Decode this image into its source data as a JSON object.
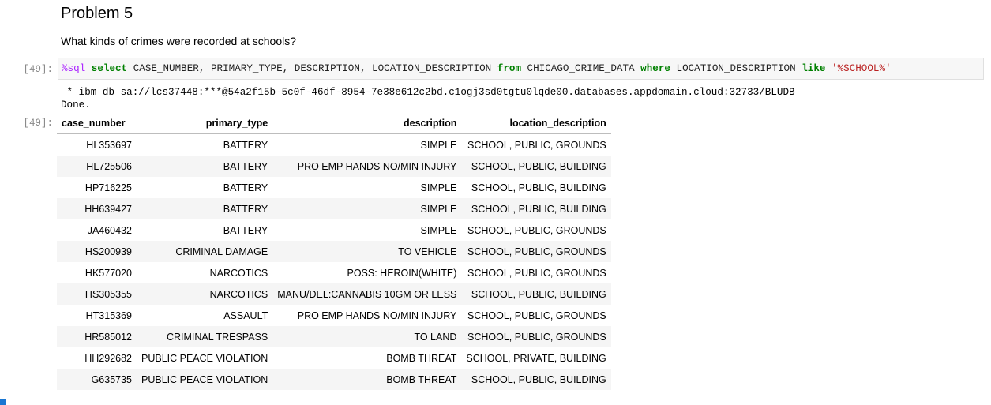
{
  "markdown": {
    "heading": "Problem 5",
    "question": "What kinds of crimes were recorded at schools?"
  },
  "input_prompt": "[49]:",
  "output_prompt": "[49]:",
  "code": {
    "magic": "%sql",
    "kw_select": "select",
    "cols": " CASE_NUMBER",
    "comma1": ",",
    "col2": " PRIMARY_TYPE",
    "comma2": ",",
    "col3": " DESCRIPTION",
    "comma3": ",",
    "col4": " LOCATION_DESCRIPTION ",
    "kw_from": "from",
    "table": " CHICAGO_CRIME_DATA ",
    "kw_where": "where",
    "where_col": " LOCATION_DESCRIPTION ",
    "kw_like": "like",
    "space": " ",
    "pattern": "'%SCHOOL%'"
  },
  "stdout": {
    "connection": " * ibm_db_sa://lcs37448:***@54a2f15b-5c0f-46df-8954-7e38e612c2bd.c1ogj3sd0tgtu0lqde00.databases.appdomain.cloud:32733/BLUDB",
    "done": "Done."
  },
  "table": {
    "headers": [
      "case_number",
      "primary_type",
      "description",
      "location_description"
    ],
    "rows": [
      [
        "HL353697",
        "BATTERY",
        "SIMPLE",
        "SCHOOL, PUBLIC, GROUNDS"
      ],
      [
        "HL725506",
        "BATTERY",
        "PRO EMP HANDS NO/MIN INJURY",
        "SCHOOL, PUBLIC, BUILDING"
      ],
      [
        "HP716225",
        "BATTERY",
        "SIMPLE",
        "SCHOOL, PUBLIC, BUILDING"
      ],
      [
        "HH639427",
        "BATTERY",
        "SIMPLE",
        "SCHOOL, PUBLIC, BUILDING"
      ],
      [
        "JA460432",
        "BATTERY",
        "SIMPLE",
        "SCHOOL, PUBLIC, GROUNDS"
      ],
      [
        "HS200939",
        "CRIMINAL DAMAGE",
        "TO VEHICLE",
        "SCHOOL, PUBLIC, GROUNDS"
      ],
      [
        "HK577020",
        "NARCOTICS",
        "POSS: HEROIN(WHITE)",
        "SCHOOL, PUBLIC, GROUNDS"
      ],
      [
        "HS305355",
        "NARCOTICS",
        "MANU/DEL:CANNABIS 10GM OR LESS",
        "SCHOOL, PUBLIC, BUILDING"
      ],
      [
        "HT315369",
        "ASSAULT",
        "PRO EMP HANDS NO/MIN INJURY",
        "SCHOOL, PUBLIC, GROUNDS"
      ],
      [
        "HR585012",
        "CRIMINAL TRESPASS",
        "TO LAND",
        "SCHOOL, PUBLIC, GROUNDS"
      ],
      [
        "HH292682",
        "PUBLIC PEACE VIOLATION",
        "BOMB THREAT",
        "SCHOOL, PRIVATE, BUILDING"
      ],
      [
        "G635735",
        "PUBLIC PEACE VIOLATION",
        "BOMB THREAT",
        "SCHOOL, PUBLIC, BUILDING"
      ]
    ]
  },
  "colors": {
    "magic": "#aa22ff",
    "keyword": "#008000",
    "string": "#ba2121",
    "prompt": "#8a8a8a",
    "stripe": "#f5f5f5",
    "active_cell_marker": "#1976d2"
  }
}
